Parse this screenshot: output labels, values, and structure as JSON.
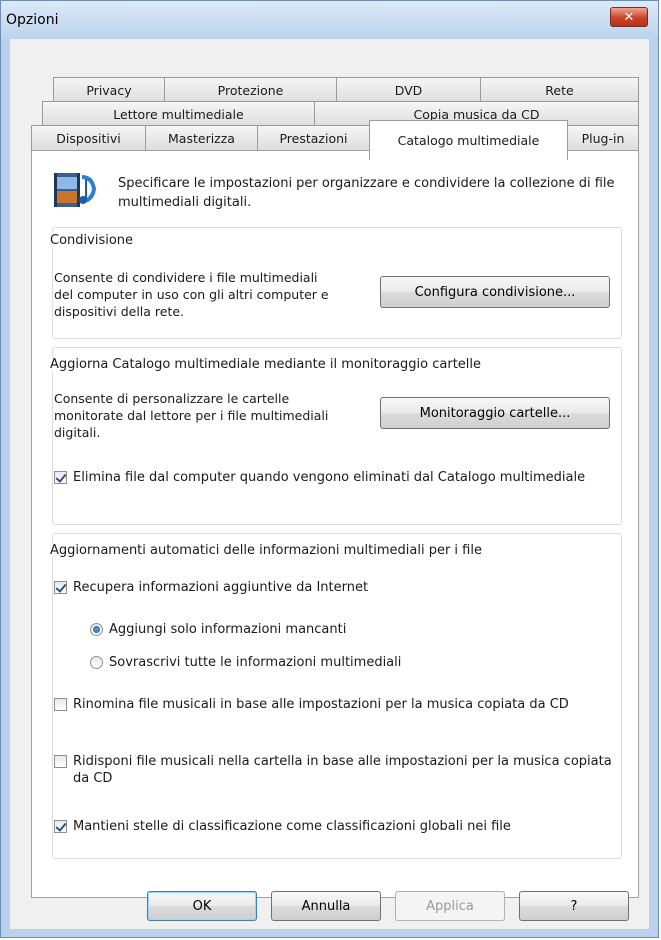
{
  "window": {
    "title": "Opzioni"
  },
  "tabs": {
    "row1": [
      "Privacy",
      "Protezione",
      "DVD",
      "Rete"
    ],
    "row2": [
      "Lettore multimediale",
      "Copia musica da CD"
    ],
    "row3": [
      "Dispositivi",
      "Masterizza",
      "Prestazioni",
      "Catalogo multimediale",
      "Plug-in"
    ],
    "active": "Catalogo multimediale"
  },
  "header": {
    "icon": "media-library-icon",
    "text": "Specificare le impostazioni per organizzare e condividere la collezione di file multimediali digitali."
  },
  "sharing": {
    "title": "Condivisione",
    "description": "Consente di condividere i file multimediali del computer in uso con gli altri computer e dispositivi della rete.",
    "button": "Configura condivisione..."
  },
  "monitoring": {
    "title": "Aggiorna Catalogo multimediale mediante il monitoraggio cartelle",
    "description": "Consente di personalizzare le cartelle monitorate dal lettore per i file multimediali digitali.",
    "button": "Monitoraggio cartelle...",
    "delete_files_label": "Elimina file dal computer quando vengono eliminati dal Catalogo multimediale",
    "delete_files_checked": true
  },
  "auto_updates": {
    "title": "Aggiornamenti automatici delle informazioni multimediali per i file",
    "retrieve_label": "Recupera informazioni aggiuntive da Internet",
    "retrieve_checked": true,
    "radio_add_label": "Aggiungi solo informazioni mancanti",
    "radio_overwrite_label": "Sovrascrivi tutte le informazioni multimediali",
    "selected_radio": "add",
    "rename_label": "Rinomina file musicali in base alle impostazioni per la musica copiata da CD",
    "rename_checked": false,
    "rearrange_label": "Ridisponi file musicali nella cartella in base alle impostazioni per la musica copiata da CD",
    "rearrange_checked": false,
    "ratings_label": "Mantieni stelle di classificazione come classificazioni globali nei file",
    "ratings_checked": true
  },
  "footer": {
    "ok": "OK",
    "cancel": "Annulla",
    "apply": "Applica",
    "help": "?"
  }
}
